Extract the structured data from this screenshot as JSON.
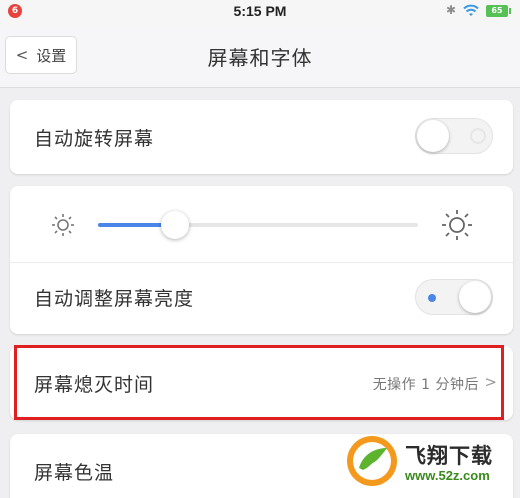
{
  "status_bar": {
    "notification_badge": "6",
    "time": "5:15 PM",
    "battery": "65",
    "icons": [
      "bluetooth-icon",
      "wifi-icon",
      "battery-icon"
    ]
  },
  "nav": {
    "back_label": "设置",
    "title": "屏幕和字体"
  },
  "settings": {
    "auto_rotate": {
      "label": "自动旋转屏幕",
      "enabled": false
    },
    "brightness": {
      "level": 0.24
    },
    "auto_brightness": {
      "label": "自动调整屏幕亮度",
      "enabled": true
    },
    "screen_timeout": {
      "label": "屏幕熄灭时间",
      "value": "无操作 1 分钟后",
      "highlighted": true
    },
    "color_temp": {
      "label": "屏幕色温"
    }
  },
  "watermark": {
    "title": "飞翔下载",
    "url": "www.52z.com"
  },
  "colors": {
    "accent": "#4a86e8",
    "highlight": "#e02020",
    "background": "#efeff1"
  }
}
